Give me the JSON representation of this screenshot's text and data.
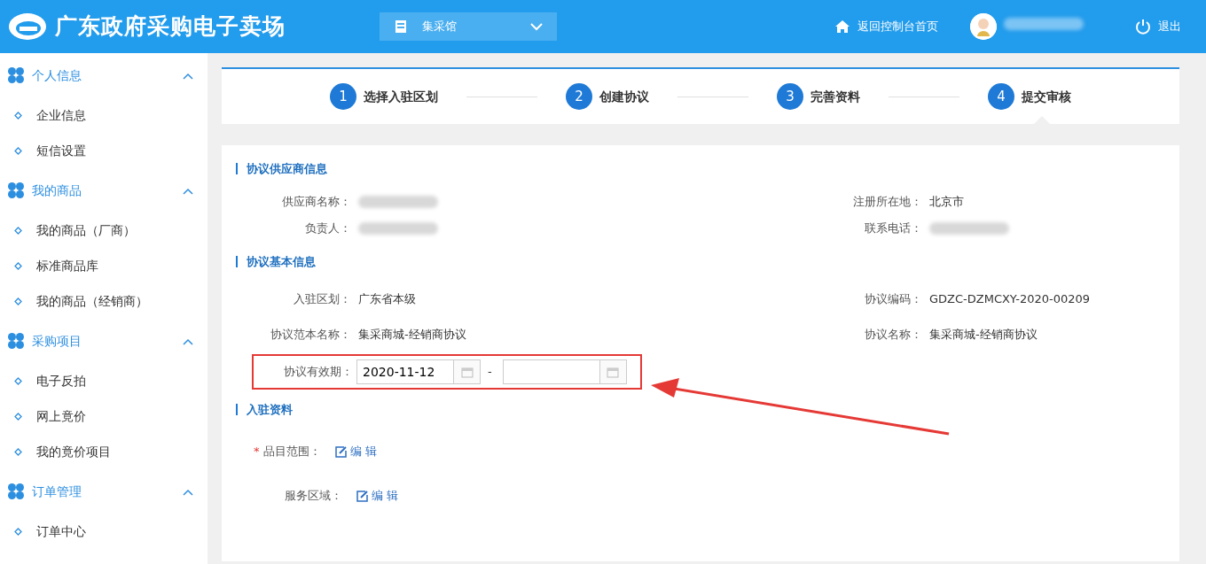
{
  "header": {
    "title": "广东政府采购电子卖场",
    "mall_select": {
      "value": "集采馆"
    },
    "home_link": "返回控制台首页",
    "user": {
      "name_redacted": true
    },
    "logout": "退出"
  },
  "sidebar": [
    {
      "title": "个人信息",
      "expanded": true,
      "items": [
        "企业信息",
        "短信设置"
      ]
    },
    {
      "title": "我的商品",
      "expanded": true,
      "items": [
        "我的商品（厂商）",
        "标准商品库",
        "我的商品（经销商）"
      ]
    },
    {
      "title": "采购项目",
      "expanded": true,
      "items": [
        "电子反拍",
        "网上竟价",
        "我的竟价项目"
      ]
    },
    {
      "title": "订单管理",
      "expanded": true,
      "items": [
        "订单中心"
      ]
    }
  ],
  "steps": [
    {
      "number": "1",
      "label": "选择入驻区划",
      "selected": false
    },
    {
      "number": "2",
      "label": "创建协议",
      "selected": false
    },
    {
      "number": "3",
      "label": "完善资料",
      "selected": false
    },
    {
      "number": "4",
      "label": "提交审核",
      "selected": true
    }
  ],
  "supplier_info": {
    "title": "协议供应商信息",
    "fields": [
      {
        "label": "供应商名称：",
        "redacted": true
      },
      {
        "label": "注册所在地：",
        "value": "北京市"
      },
      {
        "label": "负责人：",
        "redacted": true
      },
      {
        "label": "联系电话：",
        "redacted": true
      }
    ]
  },
  "basic_info": {
    "title": "协议基本信息",
    "fields": [
      {
        "label": "入驻区划：",
        "value": "广东省本级"
      },
      {
        "label": "协议编码：",
        "value": "GDZC-DZMCXY-2020-00209"
      },
      {
        "label": "协议范本名称：",
        "value": "集采商城-经销商协议"
      },
      {
        "label": "协议名称：",
        "value": "集采商城-经销商协议"
      }
    ],
    "validity": {
      "label": "协议有效期：",
      "start": "2020-11-12",
      "separator": "-",
      "highlighted": true
    }
  },
  "attachments": {
    "title": "入驻资料",
    "fields": [
      {
        "required_mark": "*",
        "label": "品目范围：",
        "action": "编 辑"
      },
      {
        "label": "服务区域：",
        "action": "编 辑"
      }
    ]
  }
}
